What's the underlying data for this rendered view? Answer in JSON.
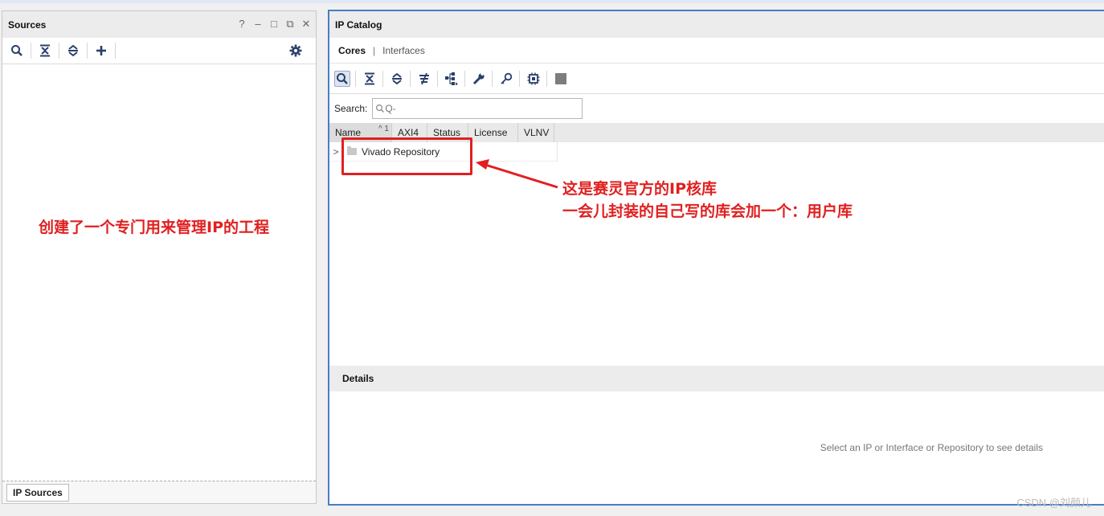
{
  "sources": {
    "title": "Sources",
    "controls": {
      "help": "?",
      "minimize": "–",
      "maximize": "□",
      "float": "⧉",
      "close": "✕"
    },
    "bottom_tab": "IP Sources"
  },
  "ip_catalog": {
    "title": "IP Catalog",
    "tabs": {
      "cores": "Cores",
      "separator": "|",
      "interfaces": "Interfaces"
    },
    "search": {
      "label": "Search:",
      "placeholder": "Q-"
    },
    "columns": {
      "name": "Name",
      "sort": "^ 1",
      "axi4": "AXI4",
      "status": "Status",
      "license": "License",
      "vlnv": "VLNV"
    },
    "rows": [
      {
        "chevron": ">",
        "name": "Vivado Repository"
      }
    ],
    "details": {
      "title": "Details",
      "message": "Select an IP or Interface or Repository to see details"
    }
  },
  "annotations": {
    "left": "创建了一个专门用来管理IP的工程",
    "right_line1": "这是赛灵官方的IP核库",
    "right_line2": "一会儿封装的自己写的库会加一个：用户库"
  },
  "watermark": "CSDN @刘颜儿",
  "colors": {
    "accent_blue": "#4a7cc7",
    "annotation_red": "#e02020",
    "icon_blue": "#2a3f6b"
  }
}
